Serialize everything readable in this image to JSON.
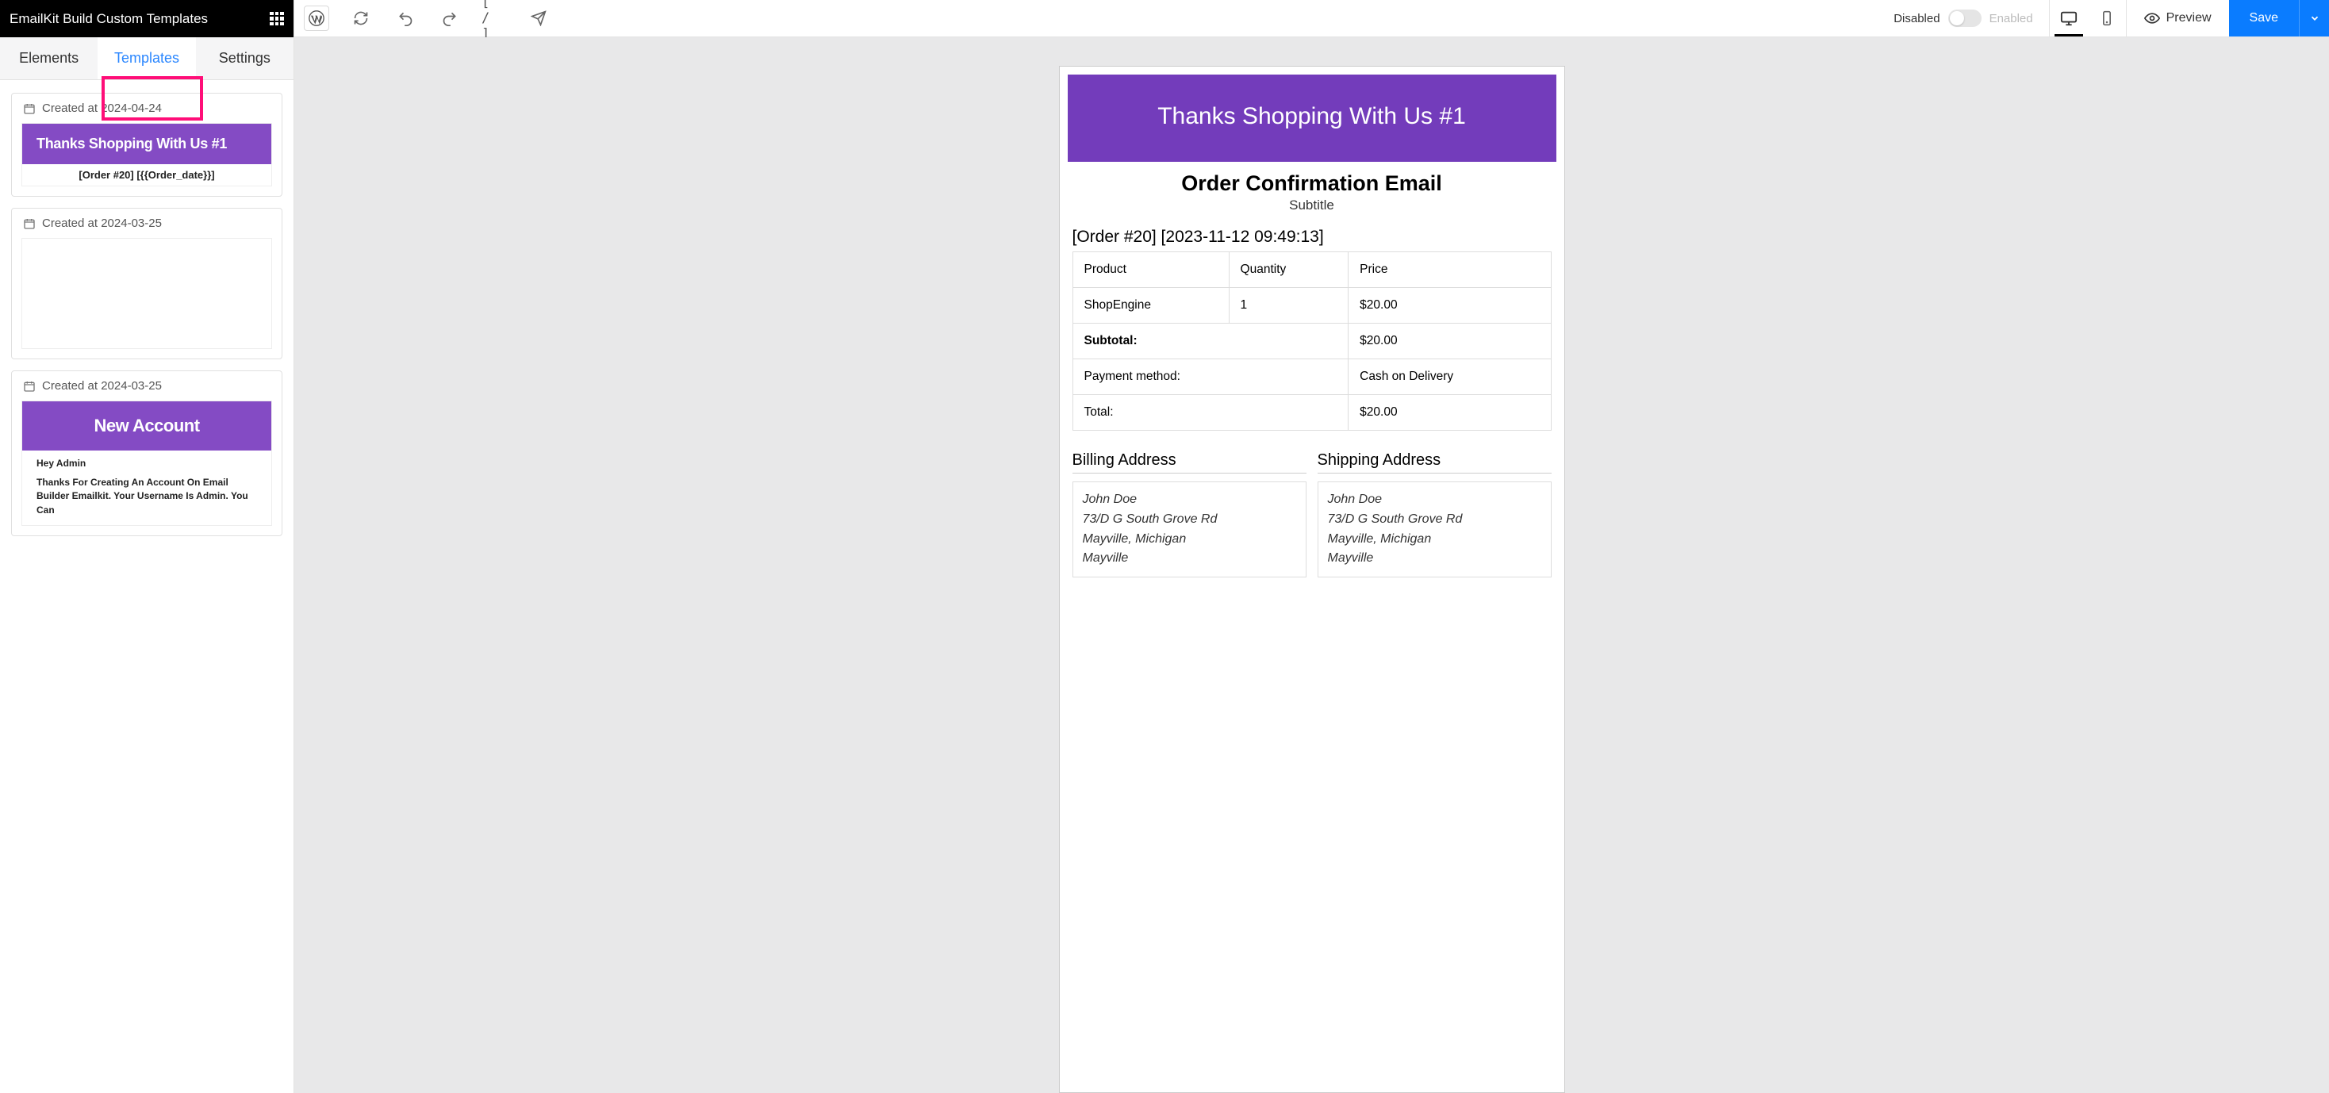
{
  "sidebar": {
    "title": "EmailKit Build Custom Templates",
    "tabs": {
      "elements": "Elements",
      "templates": "Templates",
      "settings": "Settings"
    },
    "cards": [
      {
        "created_label": "Created at 2024-04-24",
        "hero": "Thanks Shopping With Us #1",
        "sub": "[Order #20] [{{Order_date}}]"
      },
      {
        "created_label": "Created at 2024-03-25"
      },
      {
        "created_label": "Created at 2024-03-25",
        "hero": "New Account",
        "body_hi": "Hey Admin",
        "body_rest": "Thanks For Creating An Account On Email Builder Emailkit. Your Username Is Admin. You Can"
      }
    ]
  },
  "topbar": {
    "shortcode": "[ / ]",
    "disabled": "Disabled",
    "enabled": "Enabled",
    "preview": "Preview",
    "save": "Save"
  },
  "email": {
    "hero": "Thanks Shopping With Us #1",
    "title": "Order Confirmation Email",
    "subtitle": "Subtitle",
    "order_header": "[Order #20] [2023-11-12 09:49:13]",
    "cols": {
      "product": "Product",
      "quantity": "Quantity",
      "price": "Price"
    },
    "row": {
      "product": "ShopEngine",
      "quantity": "1",
      "price": "$20.00"
    },
    "subtotal_label": "Subtotal:",
    "subtotal_val": "$20.00",
    "payment_label": "Payment method:",
    "payment_val": "Cash on Delivery",
    "total_label": "Total:",
    "total_val": "$20.00",
    "billing_hd": "Billing Address",
    "shipping_hd": "Shipping Address",
    "addr": {
      "name": "John Doe",
      "street": "73/D G South Grove Rd",
      "city": "Mayville, Michigan",
      "town": "Mayville"
    }
  }
}
